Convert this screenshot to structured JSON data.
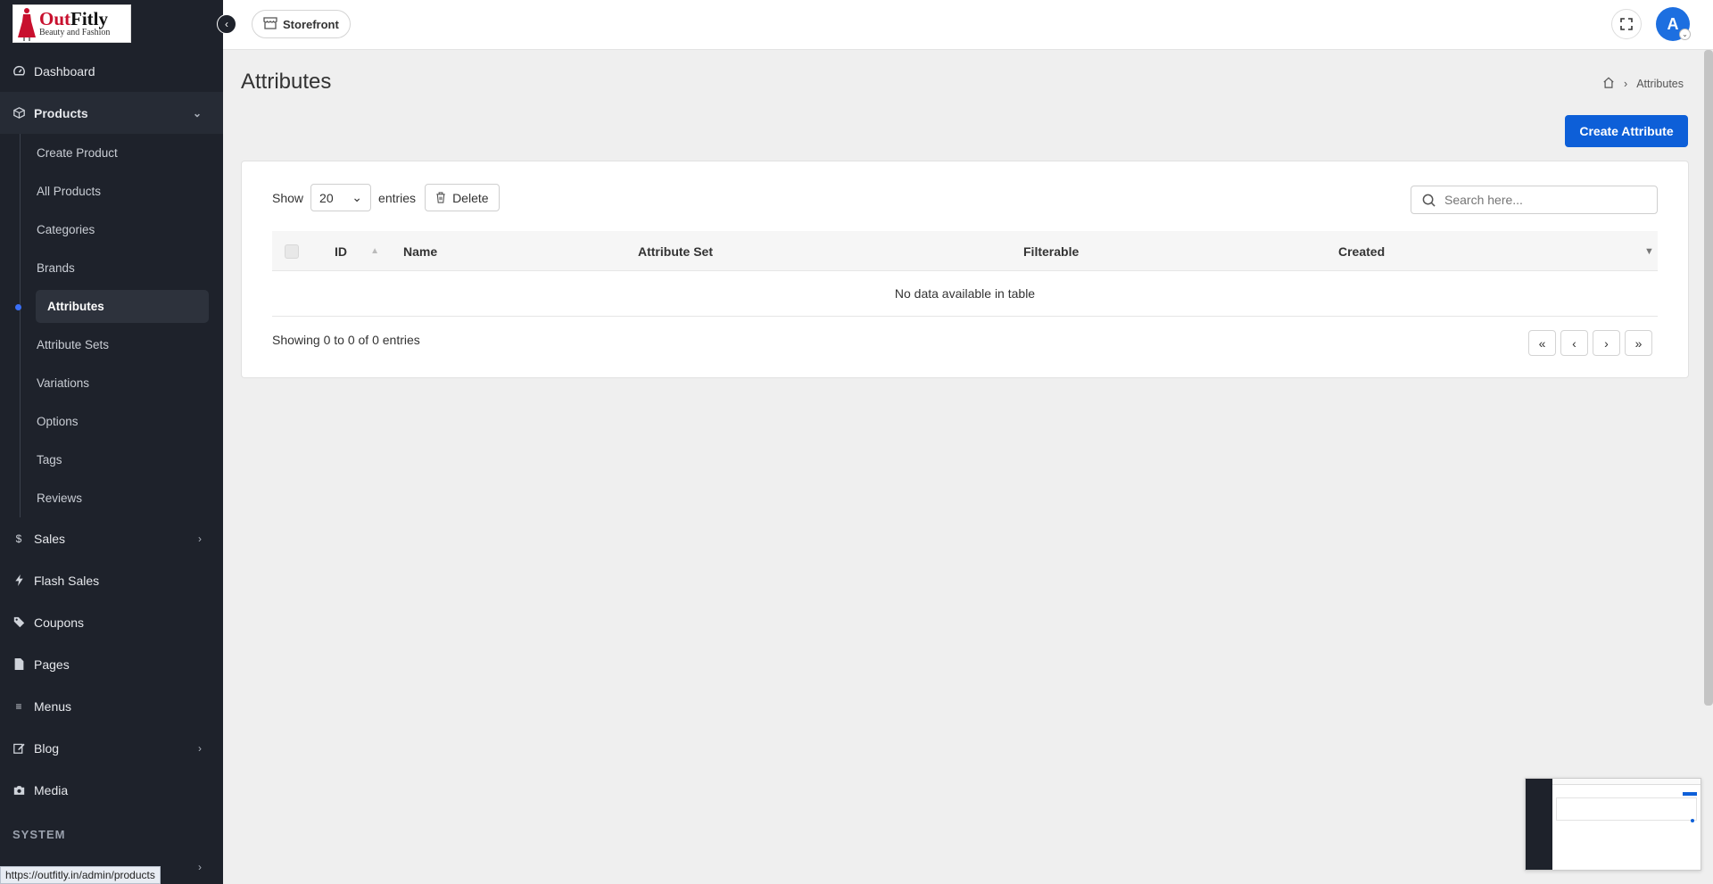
{
  "brand": {
    "name_red": "Out",
    "name_dark": "Fitly",
    "tagline": "Beauty and Fashion"
  },
  "topbar": {
    "storefront_label": "Storefront",
    "avatar_initial": "A"
  },
  "sidebar": {
    "items": [
      {
        "label": "Dashboard",
        "icon": "dashboard-icon"
      },
      {
        "label": "Products",
        "icon": "box-icon",
        "expanded": true
      },
      {
        "label": "Sales",
        "icon": "dollar-icon"
      },
      {
        "label": "Flash Sales",
        "icon": "bolt-icon"
      },
      {
        "label": "Coupons",
        "icon": "tags-icon"
      },
      {
        "label": "Pages",
        "icon": "file-icon"
      },
      {
        "label": "Menus",
        "icon": "bars-icon"
      },
      {
        "label": "Blog",
        "icon": "edit-icon"
      },
      {
        "label": "Media",
        "icon": "camera-icon"
      }
    ],
    "products_sub": [
      {
        "label": "Create Product"
      },
      {
        "label": "All Products"
      },
      {
        "label": "Categories"
      },
      {
        "label": "Brands"
      },
      {
        "label": "Attributes",
        "active": true
      },
      {
        "label": "Attribute Sets"
      },
      {
        "label": "Variations"
      },
      {
        "label": "Options"
      },
      {
        "label": "Tags"
      },
      {
        "label": "Reviews"
      }
    ],
    "section_system": "SYSTEM"
  },
  "page": {
    "title": "Attributes",
    "breadcrumb_current": "Attributes",
    "create_button": "Create Attribute"
  },
  "table": {
    "show_label": "Show",
    "entries_label": "entries",
    "page_size": "20",
    "delete_label": "Delete",
    "search_placeholder": "Search here...",
    "columns": [
      "ID",
      "Name",
      "Attribute Set",
      "Filterable",
      "Created"
    ],
    "empty_message": "No data available in table",
    "info": "Showing 0 to 0 of 0 entries",
    "pager": [
      "«",
      "‹",
      "›",
      "»"
    ]
  },
  "status_url": "https://outfitly.in/admin/products",
  "colors": {
    "sidebar_bg": "#1e222b",
    "accent": "#0d5fd8",
    "active_dot": "#3a6ff7"
  }
}
